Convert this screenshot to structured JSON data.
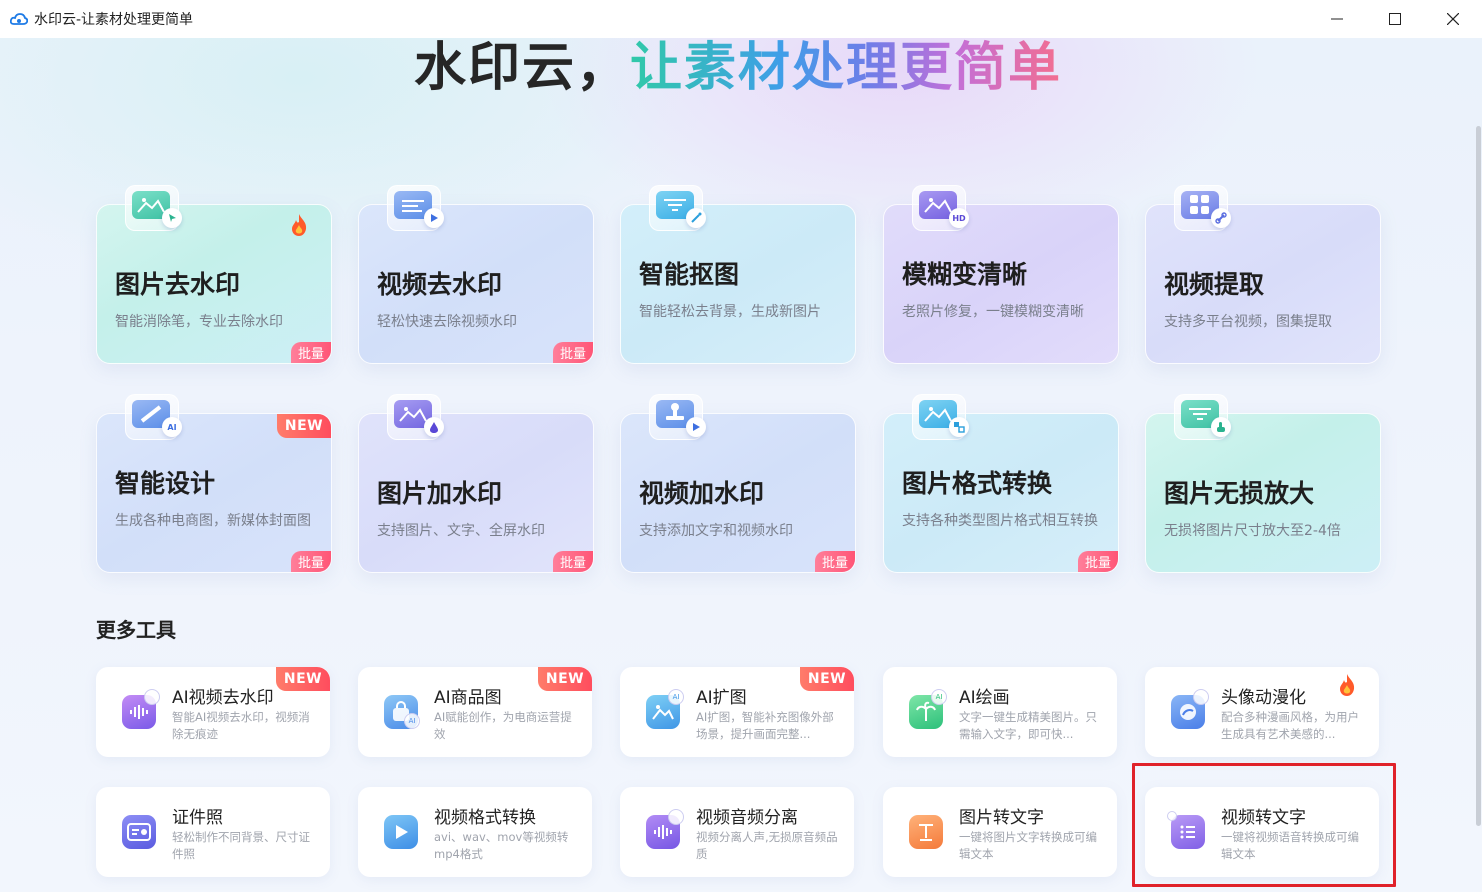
{
  "window": {
    "title": "水印云-让素材处理更简单",
    "controls": [
      "minimize",
      "maximize",
      "close"
    ]
  },
  "headline": {
    "part1": "水印云，",
    "part2": "让素材处理更简单"
  },
  "colors": {
    "batch_tag": "#ff5576",
    "new_tag": "#ff4d5e",
    "highlight_box": "#e0222a",
    "headline_gradient": [
      "#30c9a8",
      "#3f9ee8",
      "#c36fd8",
      "#f36e8f"
    ]
  },
  "feature_cards": [
    {
      "title": "图片去水印",
      "desc": "智能消除笔，专业去除水印",
      "batch": "批量",
      "badge": "fire",
      "icon": "image-cursor-icon"
    },
    {
      "title": "视频去水印",
      "desc": "轻松快速去除视频水印",
      "batch": "批量",
      "icon": "video-play-icon"
    },
    {
      "title": "智能抠图",
      "desc": "智能轻松去背景，生成新图片",
      "icon": "magic-wand-icon"
    },
    {
      "title": "模糊变清晰",
      "desc": "老照片修复，一键模糊变清晰",
      "icon": "hd-image-icon"
    },
    {
      "title": "视频提取",
      "desc": "支持多平台视频，图集提取",
      "icon": "link-grid-icon"
    },
    {
      "title": "智能设计",
      "desc": "生成各种电商图，新媒体封面图",
      "batch": "批量",
      "badge": "NEW",
      "icon": "ai-design-icon"
    },
    {
      "title": "图片加水印",
      "desc": "支持图片、文字、全屏水印",
      "batch": "批量",
      "icon": "image-drop-icon"
    },
    {
      "title": "视频加水印",
      "desc": "支持添加文字和视频水印",
      "batch": "批量",
      "icon": "stamp-play-icon"
    },
    {
      "title": "图片格式转换",
      "desc": "支持各种类型图片格式相互转换",
      "batch": "批量",
      "icon": "format-convert-icon"
    },
    {
      "title": "图片无损放大",
      "desc": "无损将图片尺寸放大至2-4倍",
      "icon": "touch-zoom-icon"
    }
  ],
  "more_tools": {
    "title": "更多工具",
    "items": [
      {
        "title": "AI视频去水印",
        "desc": "智能AI视频去水印，视频消除无痕迹",
        "badge": "NEW",
        "icon": "audio-wave-icon"
      },
      {
        "title": "AI商品图",
        "desc": "AI赋能创作，为电商运营提效",
        "badge": "NEW",
        "icon": "shopping-bag-icon"
      },
      {
        "title": "AI扩图",
        "desc": "AI扩图，智能补充图像外部场景，提升画面完整...",
        "badge": "NEW",
        "icon": "image-expand-icon"
      },
      {
        "title": "AI绘画",
        "desc": "文字一键生成精美图片。只需输入文字，即可快...",
        "icon": "palm-tree-icon"
      },
      {
        "title": "头像动漫化",
        "desc": "配合多种漫画风格，为用户生成具有艺术美感的...",
        "badge": "fire",
        "icon": "avatar-anime-icon"
      },
      {
        "title": "证件照",
        "desc": "轻松制作不同背景、尺寸证件照",
        "icon": "id-card-icon"
      },
      {
        "title": "视频格式转换",
        "desc": "avi、wav、mov等视频转mp4格式",
        "icon": "video-convert-icon"
      },
      {
        "title": "视频音频分离",
        "desc": "视频分离人声,无损原音频品质",
        "icon": "audio-separate-icon"
      },
      {
        "title": "图片转文字",
        "desc": "一键将图片文字转换成可编辑文本",
        "icon": "text-image-icon"
      },
      {
        "title": "视频转文字",
        "desc": "一键将视频语音转换成可编辑文本",
        "icon": "video-text-icon",
        "highlighted": true
      }
    ]
  }
}
